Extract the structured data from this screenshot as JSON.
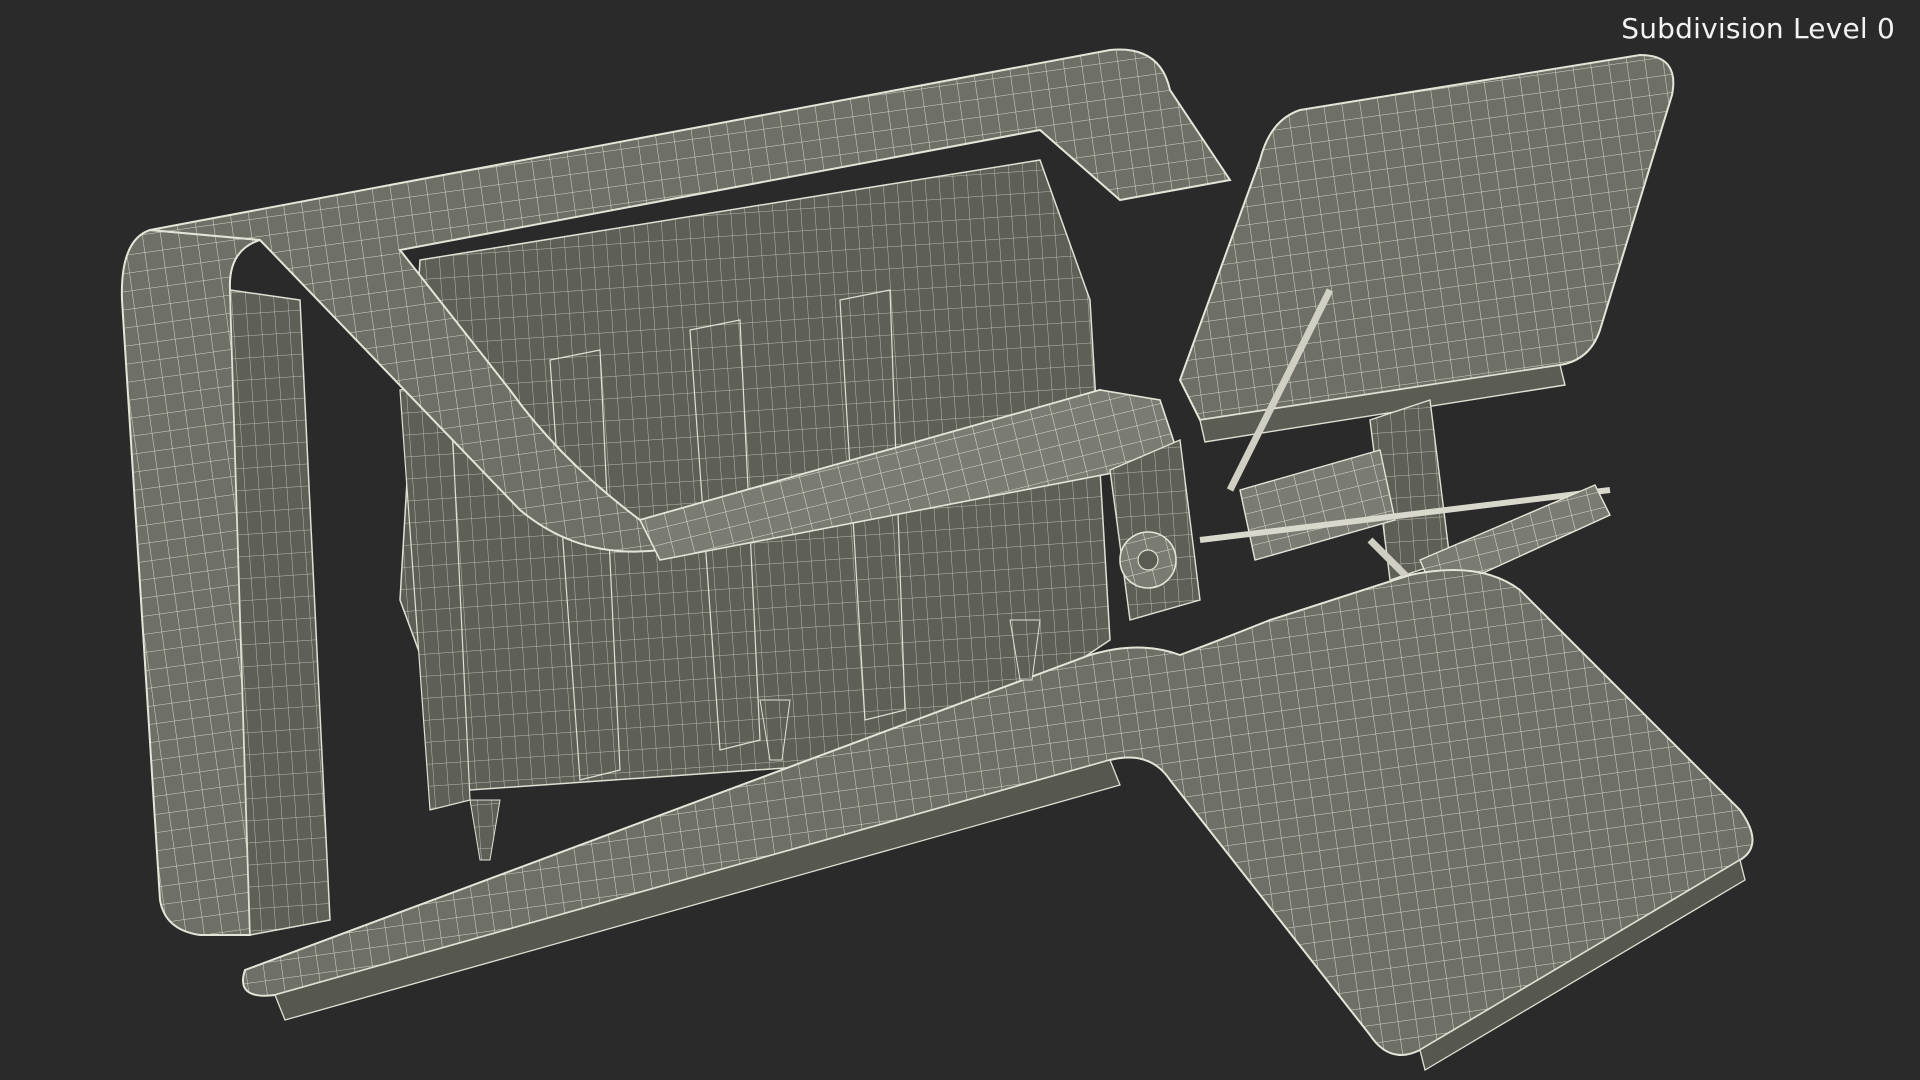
{
  "viewport": {
    "label": "Subdivision Level 0",
    "background_color": "#2a2a2a",
    "model_color": "#6e6f66",
    "wire_color": "#e6e6dc"
  }
}
